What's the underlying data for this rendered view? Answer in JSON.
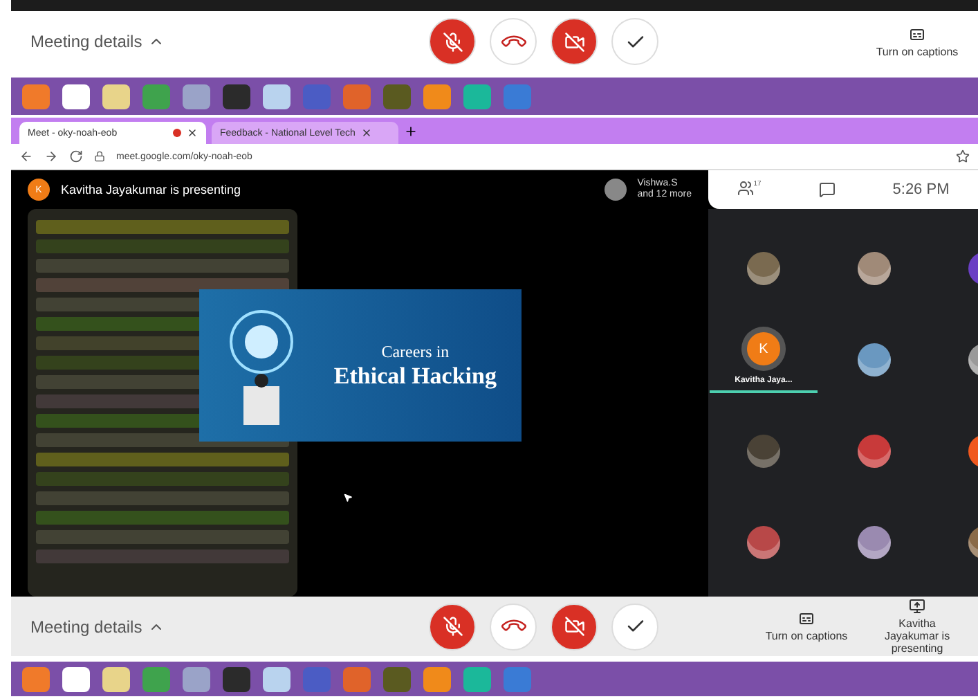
{
  "top_meeting_bar": {
    "meeting_details": "Meeting details",
    "captions": "Turn on captions",
    "controls": [
      {
        "kind": "mic",
        "muted": true
      },
      {
        "kind": "hangup"
      },
      {
        "kind": "camera",
        "muted": true
      },
      {
        "kind": "check"
      }
    ]
  },
  "taskbar_top": {
    "apps": [
      {
        "color": "#f07a2a"
      },
      {
        "color": "#ffffff"
      },
      {
        "color": "#e8d48a"
      },
      {
        "color": "#3fa34d"
      },
      {
        "color": "#9aa3c8"
      },
      {
        "color": "#2b2b2b"
      },
      {
        "color": "#b9d3ee"
      },
      {
        "color": "#4b5cc4"
      },
      {
        "color": "#e0632a"
      },
      {
        "color": "#5a5a20"
      },
      {
        "color": "#f08a1a"
      },
      {
        "color": "#1bb89a"
      },
      {
        "color": "#3a7bd5"
      }
    ]
  },
  "browser": {
    "tabs": [
      {
        "title": "Meet - oky-noah-eob",
        "selected": true,
        "recording": true
      },
      {
        "title": "Feedback - National Level Tech",
        "selected": false,
        "recording": false
      }
    ],
    "url": "meet.google.com/oky-noah-eob"
  },
  "meet_header": {
    "presenter_initial": "K",
    "presenter_text": "Kavitha Jayakumar is presenting",
    "viewer_name": "Vishwa.S",
    "viewer_more": "and 12 more",
    "participant_count": "17",
    "time": "5:26 PM"
  },
  "slide": {
    "line_1": "Careers in",
    "line_2": "Ethical Hacking"
  },
  "participants": [
    {
      "kind": "photo",
      "color": "#7a6a50"
    },
    {
      "kind": "photo",
      "color": "#a08a78"
    },
    {
      "kind": "letter",
      "color": "#6a3fc4"
    },
    {
      "kind": "letter",
      "color": "#f07c16",
      "letter": "K",
      "name": "Kavitha Jaya...",
      "speaking": true
    },
    {
      "kind": "photo",
      "color": "#6a98c0"
    },
    {
      "kind": "photo",
      "color": "#9a9a9a"
    },
    {
      "kind": "photo",
      "color": "#4a4236"
    },
    {
      "kind": "photo",
      "color": "#c83a3a"
    },
    {
      "kind": "letter",
      "color": "#f0581e"
    },
    {
      "kind": "photo",
      "color": "#b84848"
    },
    {
      "kind": "photo",
      "color": "#9a8ab0"
    },
    {
      "kind": "photo",
      "color": "#8a6a48"
    }
  ],
  "bottom_meeting_bar": {
    "meeting_details": "Meeting details",
    "captions": "Turn on captions",
    "presenting": "Kavitha Jayakumar is presenting",
    "controls": [
      {
        "kind": "mic",
        "muted": true
      },
      {
        "kind": "hangup"
      },
      {
        "kind": "camera",
        "muted": true
      },
      {
        "kind": "check"
      }
    ]
  },
  "taskbar_bottom": {
    "apps": [
      {
        "color": "#f07a2a"
      },
      {
        "color": "#ffffff"
      },
      {
        "color": "#e8d48a"
      },
      {
        "color": "#3fa34d"
      },
      {
        "color": "#9aa3c8"
      },
      {
        "color": "#2b2b2b"
      },
      {
        "color": "#b9d3ee"
      },
      {
        "color": "#4b5cc4"
      },
      {
        "color": "#e0632a"
      },
      {
        "color": "#5a5a20"
      },
      {
        "color": "#f08a1a"
      },
      {
        "color": "#1bb89a"
      },
      {
        "color": "#3a7bd5"
      }
    ]
  }
}
